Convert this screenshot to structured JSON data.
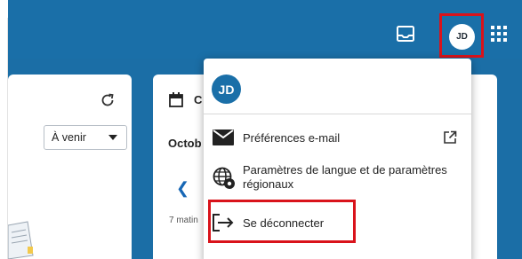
{
  "header": {
    "avatar_initials": "JD",
    "icons": [
      "inbox-tray-icon",
      "apps-grid-icon"
    ],
    "highlight_color": "#d9131b"
  },
  "left_panel": {
    "filter_select_value": "À venir"
  },
  "calendar_panel": {
    "title_partial": "C",
    "month_partial": "Octob",
    "time_partial": "7 matin"
  },
  "account_menu": {
    "avatar_initials": "JD",
    "items": [
      {
        "label": "Préférences e-mail",
        "icon": "mail-icon",
        "trailing_icon": "open-external-icon"
      },
      {
        "label": "Paramètres de langue et de paramètres régionaux",
        "icon": "globe-settings-icon"
      },
      {
        "label": "Se déconnecter",
        "icon": "sign-out-icon"
      }
    ]
  },
  "colors": {
    "header_blue": "#1a6fa8",
    "avatar_blue": "#1a6fa8",
    "link_blue": "#1767b5"
  }
}
